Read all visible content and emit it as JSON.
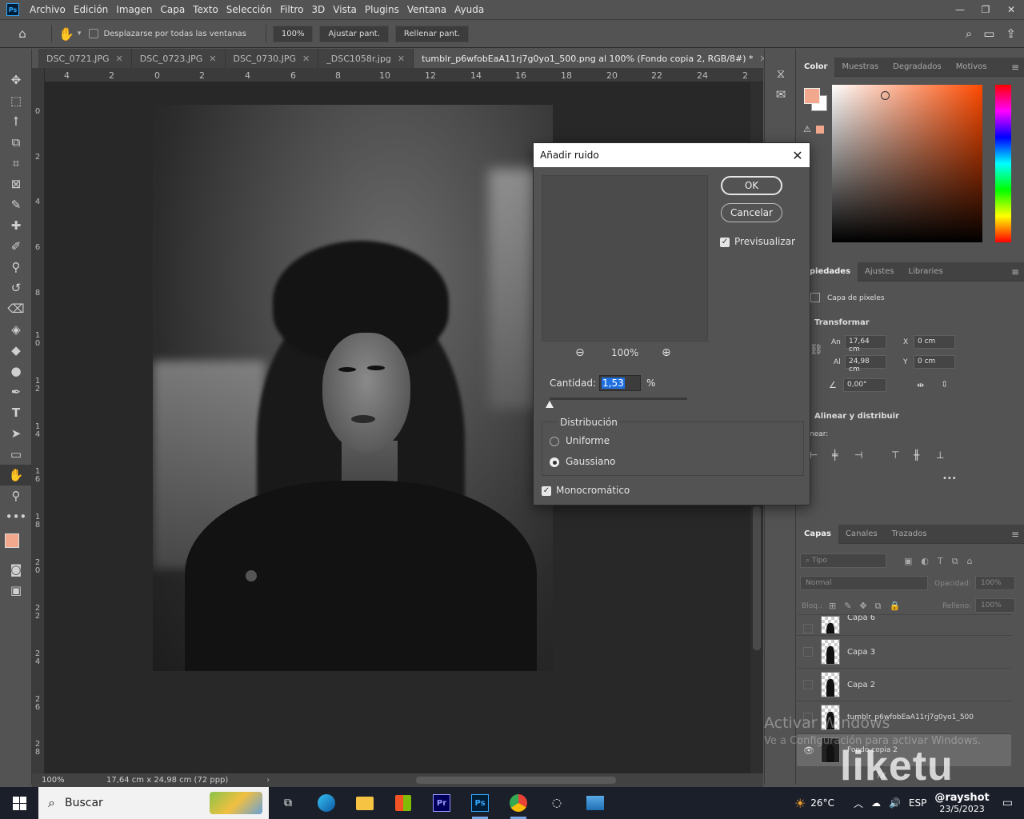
{
  "menu": {
    "logo": "Ps",
    "items": [
      "Archivo",
      "Edición",
      "Imagen",
      "Capa",
      "Texto",
      "Selección",
      "Filtro",
      "3D",
      "Vista",
      "Plugins",
      "Ventana",
      "Ayuda"
    ],
    "window_controls": [
      "—",
      "❐",
      "✕"
    ]
  },
  "options": {
    "scroll_all_label": "Desplazarse por todas las ventanas",
    "zoom_button": "100%",
    "fit_button": "Ajustar pant.",
    "fill_button": "Rellenar pant."
  },
  "tabs": [
    {
      "label": "DSC_0721.JPG",
      "active": false
    },
    {
      "label": "DSC_0723.JPG",
      "active": false
    },
    {
      "label": "DSC_0730.JPG",
      "active": false
    },
    {
      "label": "_DSC1058r.jpg",
      "active": false
    },
    {
      "label": "tumblr_p6wfobEaA11rj7g0yo1_500.png al 100% (Fondo copia 2, RGB/8#) *",
      "active": true
    }
  ],
  "ruler": {
    "top": [
      "4",
      "2",
      "0",
      "2",
      "4",
      "6",
      "8",
      "10",
      "12",
      "14",
      "16",
      "18",
      "20",
      "22",
      "24",
      "2"
    ],
    "left": [
      "0",
      "2",
      "4",
      "6",
      "8",
      "1\n0",
      "1\n2",
      "1\n4",
      "1\n6",
      "1\n8",
      "2\n0",
      "2\n2",
      "2\n4",
      "2\n6",
      "2\n8"
    ]
  },
  "status": {
    "zoom": "100%",
    "doc_size": "17,64 cm x 24,98 cm (72 ppp)"
  },
  "color_panel": {
    "tabs": [
      "Color",
      "Muestras",
      "Degradados",
      "Motivos"
    ],
    "foreground": "#f1a88d",
    "background": "#ffffff"
  },
  "properties": {
    "tabs": [
      "opiedades",
      "Ajustes",
      "Libraries"
    ],
    "layer_type": "Capa de píxeles",
    "transform_title": "Transformar",
    "an_label": "An",
    "an_value": "17,64 cm",
    "al_label": "Al",
    "al_value": "24,98 cm",
    "x_label": "X",
    "x_value": "0 cm",
    "y_label": "Y",
    "y_value": "0 cm",
    "angle_value": "0,00°",
    "align_title": "Alinear y distribuir",
    "align_sub": "near:",
    "more": "•••"
  },
  "layers_panel": {
    "tabs": [
      "Capas",
      "Canales",
      "Trazados"
    ],
    "filter_placeholder": "Tipo",
    "blend_mode": "Normal",
    "opacity_label": "Opacidad:",
    "opacity_value": "100%",
    "lock_label": "Bloq.:",
    "fill_label": "Relleno:",
    "fill_value": "100%",
    "layers": [
      {
        "name": "Capa 6",
        "visible": false,
        "selected": false
      },
      {
        "name": "Capa 3",
        "visible": false,
        "selected": false
      },
      {
        "name": "Capa 2",
        "visible": false,
        "selected": false
      },
      {
        "name": "tumblr_p6wfobEaA11rj7g0yo1_500",
        "visible": false,
        "selected": false
      },
      {
        "name": "Fondo copia 2",
        "visible": true,
        "selected": true
      }
    ]
  },
  "dialog": {
    "title": "Añadir ruido",
    "ok": "OK",
    "cancel": "Cancelar",
    "preview_label": "Previsualizar",
    "preview_checked": true,
    "zoom": "100%",
    "amount_label": "Cantidad:",
    "amount_value": "1,53",
    "amount_unit": "%",
    "distribution_label": "Distribución",
    "uniform_label": "Uniforme",
    "gaussian_label": "Gaussiano",
    "selected_distribution": "Gaussiano",
    "mono_label": "Monocromático",
    "mono_checked": true
  },
  "watermark": {
    "activate_title": "Activar Windows",
    "activate_sub": "Ve a Configuración para activar Windows.",
    "liketu": "liketu",
    "user": "@rayshot"
  },
  "taskbar": {
    "search_label": "Buscar",
    "weather": "26°C",
    "language": "ESP",
    "time": "23/5/2023",
    "pinned": [
      "task-view",
      "edge",
      "file-explorer",
      "store",
      "premiere",
      "photoshop",
      "chrome",
      "app-ring",
      "photos"
    ]
  }
}
